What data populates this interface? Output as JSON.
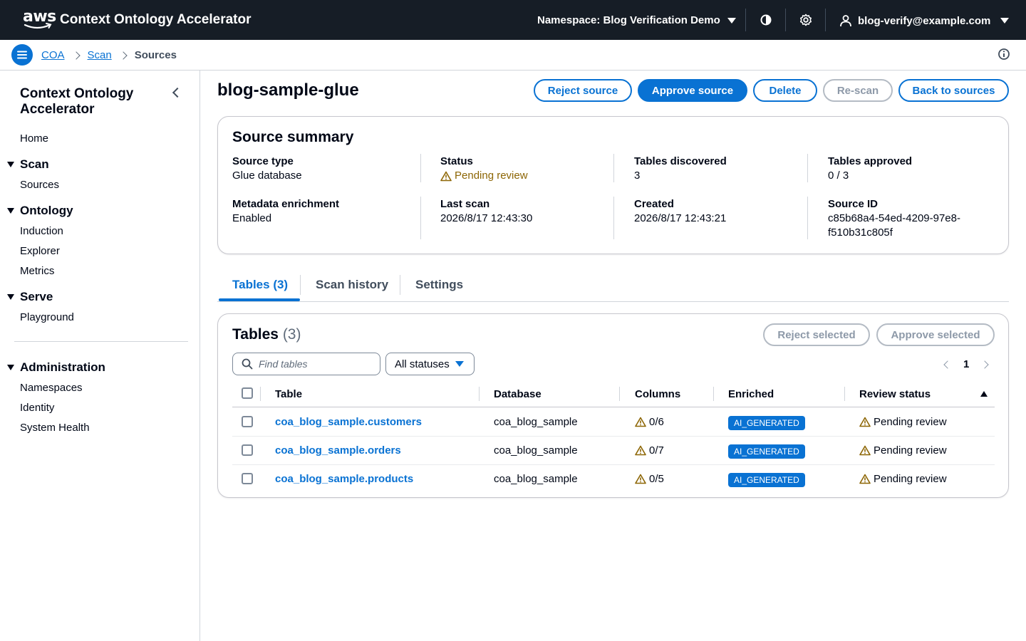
{
  "header": {
    "logo_text": "aws",
    "app_title": "Context Ontology Accelerator",
    "namespace_label": "Namespace: Blog Verification Demo",
    "user_email": "blog-verify@example.com"
  },
  "breadcrumbs": {
    "items": [
      "COA",
      "Scan"
    ],
    "current": "Sources"
  },
  "sidebar": {
    "title": "Context Ontology Accelerator",
    "home": "Home",
    "sections": [
      {
        "label": "Scan",
        "items": [
          "Sources"
        ]
      },
      {
        "label": "Ontology",
        "items": [
          "Induction",
          "Explorer",
          "Metrics"
        ]
      },
      {
        "label": "Serve",
        "items": [
          "Playground"
        ]
      },
      {
        "label": "Administration",
        "items": [
          "Namespaces",
          "Identity",
          "System Health"
        ]
      }
    ]
  },
  "page": {
    "title": "blog-sample-glue",
    "actions": {
      "reject": "Reject source",
      "approve": "Approve source",
      "delete": "Delete",
      "rescan": "Re-scan",
      "back": "Back to sources"
    }
  },
  "summary": {
    "title": "Source summary",
    "fields": {
      "source_type": {
        "label": "Source type",
        "value": "Glue database"
      },
      "status": {
        "label": "Status",
        "value": "Pending review"
      },
      "tables_discovered": {
        "label": "Tables discovered",
        "value": "3"
      },
      "tables_approved": {
        "label": "Tables approved",
        "value": "0 / 3"
      },
      "metadata_enrichment": {
        "label": "Metadata enrichment",
        "value": "Enabled"
      },
      "last_scan": {
        "label": "Last scan",
        "value": "2026/8/17 12:43:30"
      },
      "created": {
        "label": "Created",
        "value": "2026/8/17 12:43:21"
      },
      "source_id": {
        "label": "Source ID",
        "value_line1": "c85b68a4-54ed-4209-97e8-",
        "value_line2": "f510b31c805f"
      }
    }
  },
  "tabs": [
    "Tables (3)",
    "Scan history",
    "Settings"
  ],
  "tables_card": {
    "title": "Tables",
    "count": "(3)",
    "reject_selected": "Reject selected",
    "approve_selected": "Approve selected",
    "search_placeholder": "Find tables",
    "status_filter": "All statuses",
    "page_number": "1",
    "columns": [
      "Table",
      "Database",
      "Columns",
      "Enriched",
      "Review status"
    ],
    "rows": [
      {
        "table": "coa_blog_sample.customers",
        "database": "coa_blog_sample",
        "columns": "0/6",
        "enriched": "AI_GENERATED",
        "review_status": "Pending review"
      },
      {
        "table": "coa_blog_sample.orders",
        "database": "coa_blog_sample",
        "columns": "0/7",
        "enriched": "AI_GENERATED",
        "review_status": "Pending review"
      },
      {
        "table": "coa_blog_sample.products",
        "database": "coa_blog_sample",
        "columns": "0/5",
        "enriched": "AI_GENERATED",
        "review_status": "Pending review"
      }
    ]
  },
  "colors": {
    "header_bg": "#161d26",
    "accent": "#0972d3",
    "warning": "#8d6605"
  },
  "icons": [
    "aws-logo-icon",
    "caret-down-icon",
    "contrast-icon",
    "gear-icon",
    "user-icon",
    "menu-icon",
    "info-icon",
    "warning-icon",
    "search-icon",
    "chevron-left-icon",
    "chevron-right-icon",
    "sort-ascending-icon"
  ]
}
